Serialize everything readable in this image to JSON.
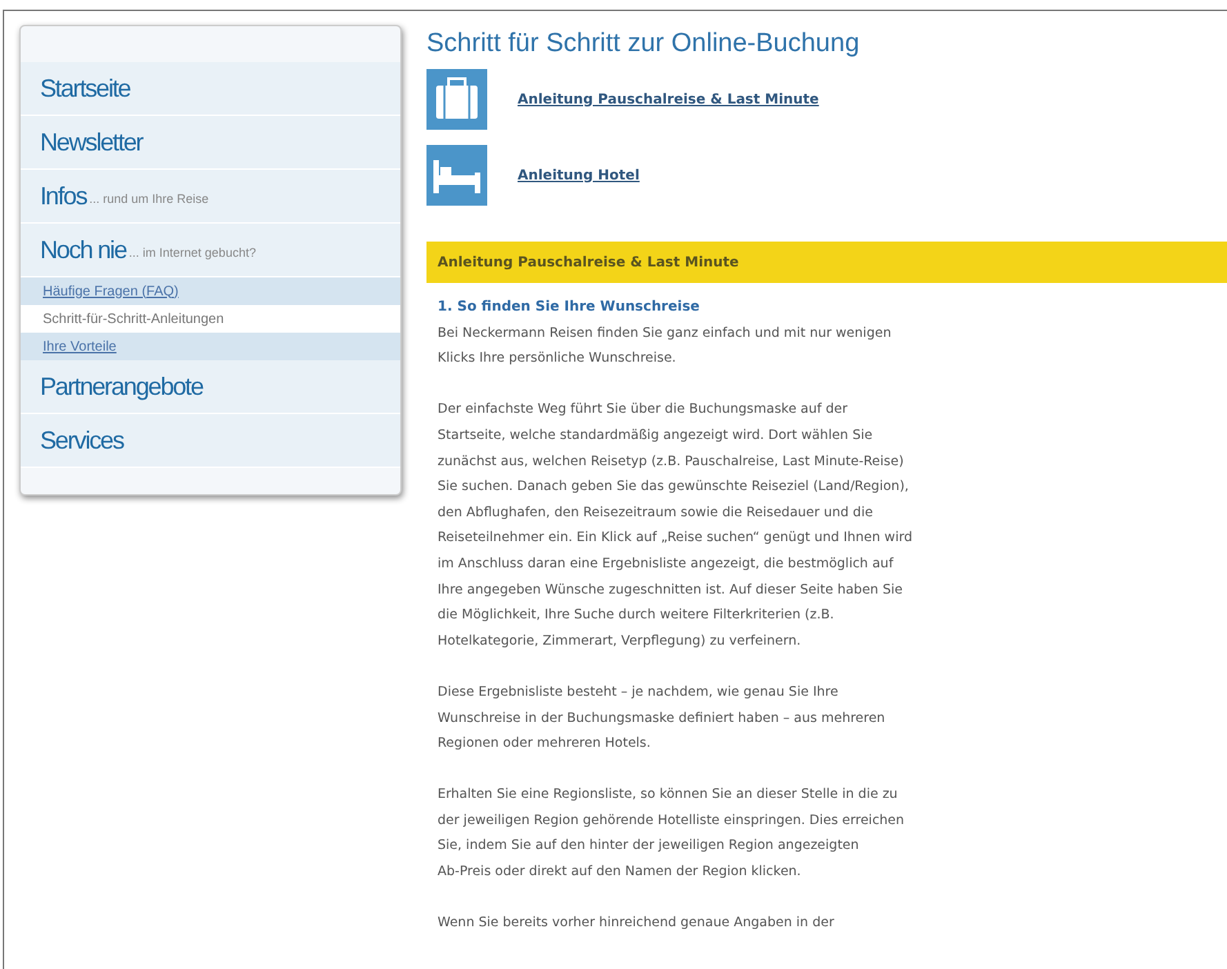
{
  "sidebar": {
    "items": [
      {
        "label": "Startseite"
      },
      {
        "label": "Newsletter"
      },
      {
        "label": "Infos",
        "suffix": "... rund um Ihre Reise"
      },
      {
        "label": "Noch nie",
        "suffix": "... im Internet gebucht?",
        "children": [
          {
            "label": "Häufige Fragen (FAQ)",
            "selected": false
          },
          {
            "label": "Schritt-für-Schritt-Anleitungen",
            "selected": true
          },
          {
            "label": "Ihre Vorteile",
            "selected": false
          }
        ]
      },
      {
        "label": "Partnerangebote"
      },
      {
        "label": "Services"
      }
    ]
  },
  "main": {
    "title": "Schritt für Schritt zur Online-Buchung",
    "guides": [
      {
        "kind": "suitcase",
        "label": "Anleitung Pauschalreise & Last Minute"
      },
      {
        "kind": "bed",
        "label": "Anleitung Hotel"
      }
    ],
    "section_title": "Anleitung Pauschalreise & Last Minute",
    "subheading": "1. So finden Sie Ihre Wunschreise",
    "paragraphs": [
      [
        "Bei Neckermann Reisen finden Sie ganz einfach und mit nur wenigen",
        "Klicks Ihre persönliche Wunschreise."
      ],
      [
        "Der einfachste Weg führt Sie über die Buchungsmaske auf der",
        "Startseite, welche standardmäßig angezeigt wird. Dort wählen Sie",
        "zunächst aus, welchen Reisetyp (z.B. Pauschalreise, Last Minute-Reise)",
        "Sie suchen. Danach geben Sie das gewünschte Reiseziel (Land/Region),",
        "den Abflughafen, den Reisezeitraum sowie die Reisedauer und die",
        "Reiseteilnehmer ein. Ein Klick auf „Reise suchen“ genügt und Ihnen wird",
        "im Anschluss daran eine Ergebnisliste angezeigt, die bestmöglich auf",
        "Ihre angegeben Wünsche zugeschnitten ist. Auf dieser Seite haben Sie",
        "die Möglichkeit, Ihre Suche durch weitere Filterkriterien (z.B.",
        "Hotelkategorie, Zimmerart, Verpflegung) zu verfeinern."
      ],
      [
        "Diese Ergebnisliste besteht – je nachdem, wie genau Sie Ihre",
        "Wunschreise in der Buchungsmaske definiert haben – aus mehreren",
        "Regionen oder mehreren Hotels."
      ],
      [
        "Erhalten Sie eine Regionsliste, so können Sie an dieser Stelle in die zu",
        "der jeweiligen Region gehörende Hotelliste einspringen. Dies erreichen",
        "Sie, indem Sie auf den hinter der jeweiligen Region angezeigten",
        "Ab-Preis oder direkt auf den Namen der Region klicken."
      ],
      [
        "Wenn Sie bereits vorher hinreichend genaue Angaben in der"
      ]
    ]
  }
}
